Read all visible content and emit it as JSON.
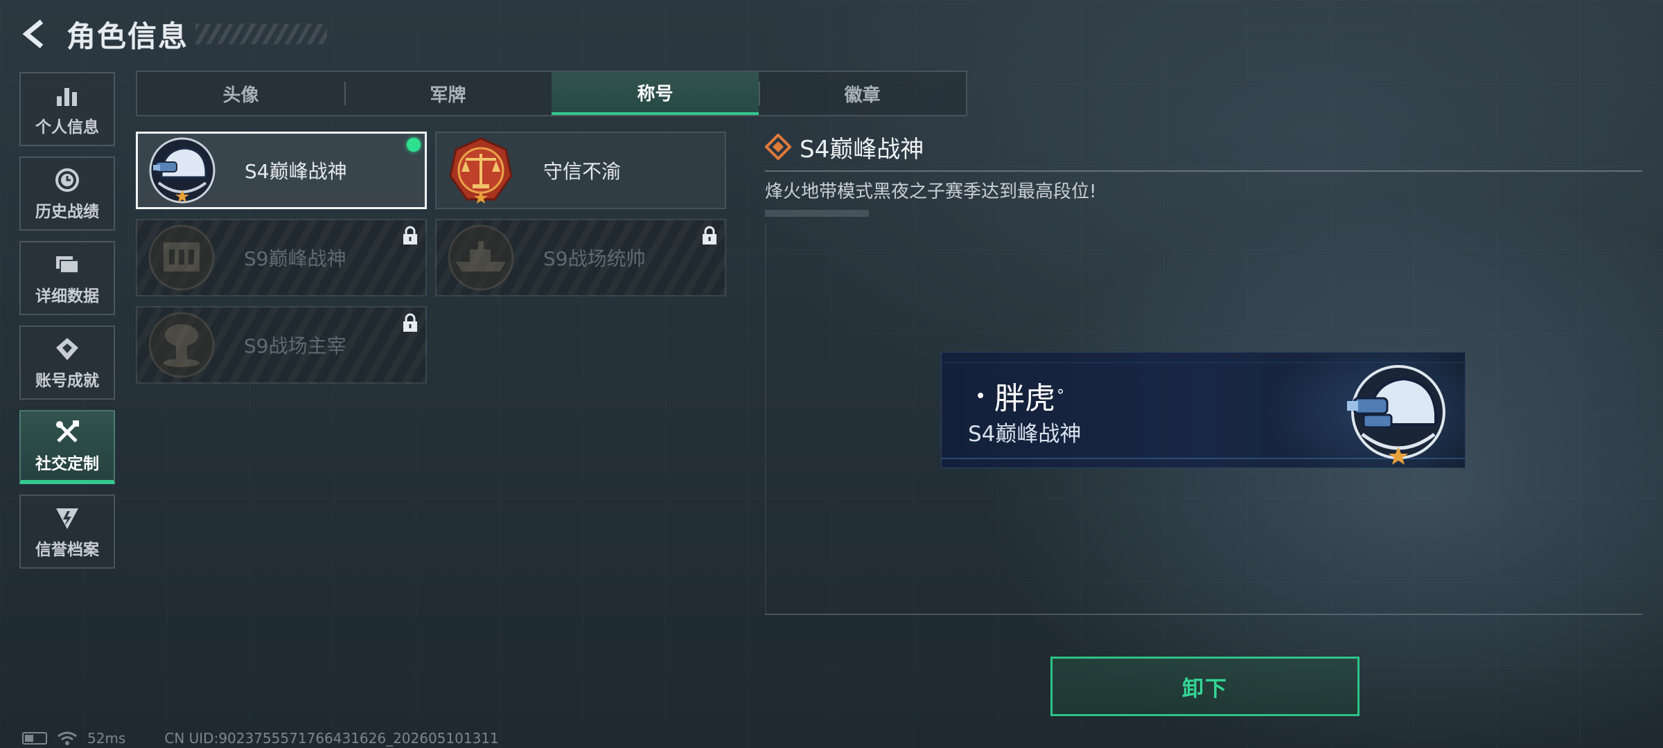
{
  "header": {
    "title": "角色信息"
  },
  "sidebar": {
    "items": [
      {
        "label": "个人信息",
        "icon": "bar-chart-icon",
        "active": false
      },
      {
        "label": "历史战绩",
        "icon": "clock-icon",
        "active": false
      },
      {
        "label": "详细数据",
        "icon": "folder-icon",
        "active": false
      },
      {
        "label": "账号成就",
        "icon": "achievement-icon",
        "active": false
      },
      {
        "label": "社交定制",
        "icon": "tools-icon",
        "active": true
      },
      {
        "label": "信誉档案",
        "icon": "shield-icon",
        "active": false
      }
    ]
  },
  "tabs": [
    {
      "label": "头像",
      "active": false
    },
    {
      "label": "军牌",
      "active": false
    },
    {
      "label": "称号",
      "active": true
    },
    {
      "label": "徽章",
      "active": false
    }
  ],
  "titles": [
    {
      "name": "S4巅峰战神",
      "state": "equipped",
      "emblem": "helmet-emblem-icon"
    },
    {
      "name": "守信不渝",
      "state": "owned",
      "emblem": "scales-emblem-icon"
    },
    {
      "name": "S9巅峰战神",
      "state": "locked",
      "emblem": "fortress-emblem-icon"
    },
    {
      "name": "S9战场统帅",
      "state": "locked",
      "emblem": "warship-emblem-icon"
    },
    {
      "name": "S9战场主宰",
      "state": "locked",
      "emblem": "mushroom-cloud-emblem-icon"
    }
  ],
  "detail": {
    "title": "S4巅峰战神",
    "description": "烽火地带模式黑夜之子赛季达到最高段位!"
  },
  "nameplate": {
    "player_name": "胖虎",
    "player_suffix": "°",
    "title": "S4巅峰战神"
  },
  "actions": {
    "unequip_label": "卸下"
  },
  "status_bar": {
    "latency": "52ms",
    "uid": "CN UID:9023755571766431626_202605101311"
  },
  "colors": {
    "accent": "#35c78f",
    "equipped_dot": "#2fe08f",
    "nameplate_bg": "#182744"
  }
}
